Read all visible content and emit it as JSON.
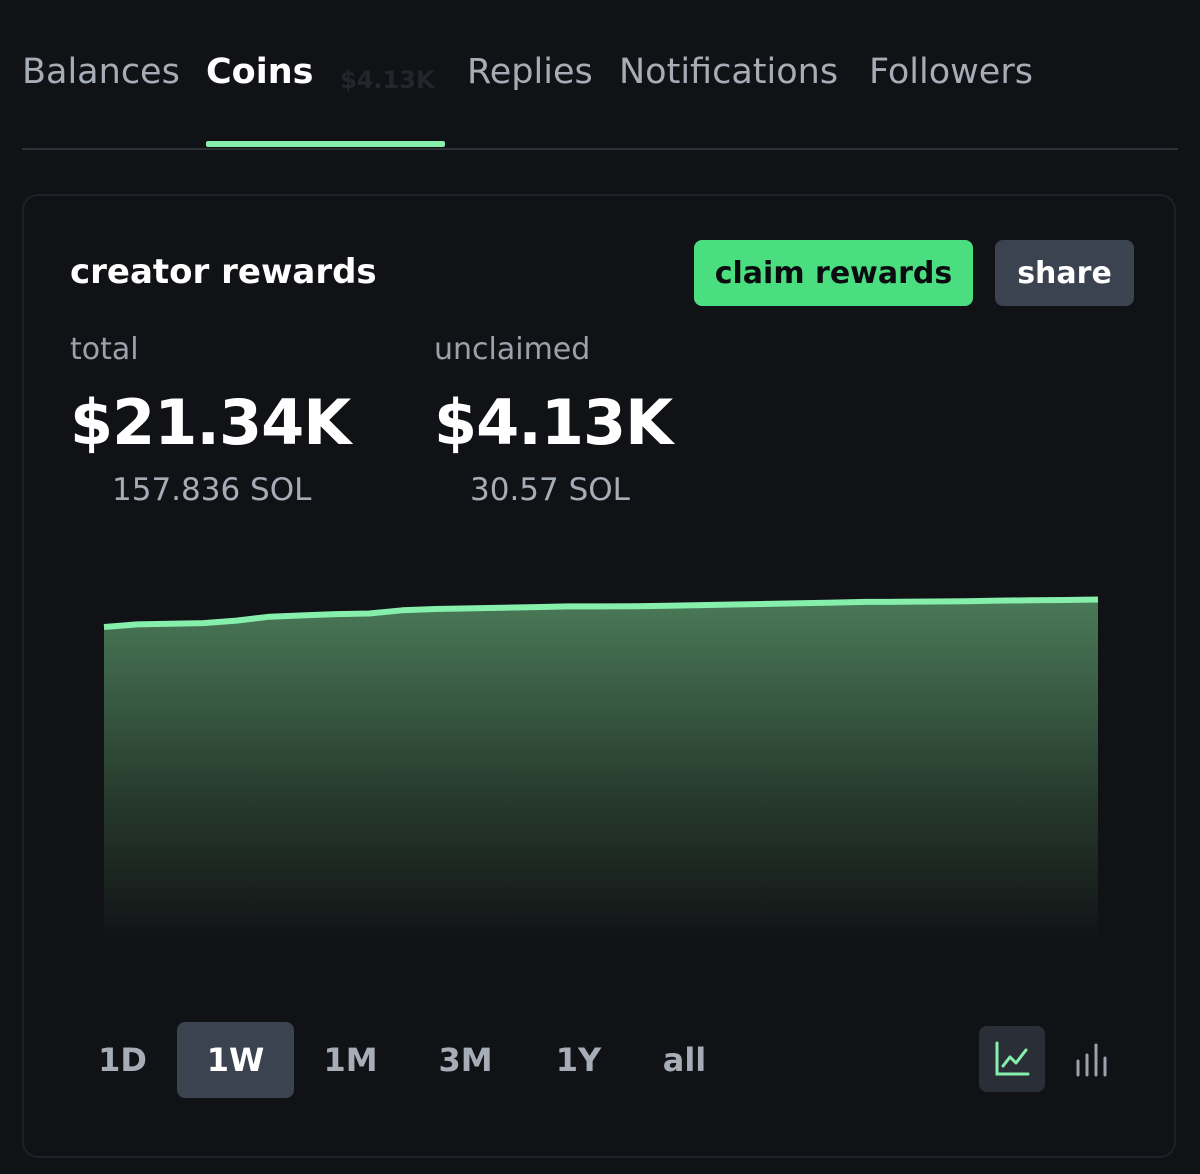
{
  "tabs": [
    {
      "label": "Balances",
      "active": false
    },
    {
      "label": "Coins",
      "active": true
    },
    {
      "label": "$4.13K",
      "active": false,
      "badge": true
    },
    {
      "label": "Replies",
      "active": false
    },
    {
      "label": "Notifications",
      "active": false
    },
    {
      "label": "Followers",
      "active": false
    }
  ],
  "card": {
    "title": "creator rewards",
    "claim_label": "claim rewards",
    "share_label": "share",
    "total": {
      "label": "total",
      "value": "$21.34K",
      "sub": "157.836 SOL"
    },
    "unclaimed": {
      "label": "unclaimed",
      "value": "$4.13K",
      "sub": "30.57 SOL"
    }
  },
  "time_ranges": [
    {
      "label": "1D",
      "active": false
    },
    {
      "label": "1W",
      "active": true
    },
    {
      "label": "1M",
      "active": false
    },
    {
      "label": "3M",
      "active": false
    },
    {
      "label": "1Y",
      "active": false
    },
    {
      "label": "all",
      "active": false
    }
  ],
  "chart_toggles": [
    {
      "icon": "line-chart-icon",
      "active": true
    },
    {
      "icon": "bar-chart-icon",
      "active": false
    }
  ],
  "colors": {
    "accent": "#4ade80",
    "line": "#86efac",
    "background": "#111216",
    "button_secondary": "#3b4350"
  },
  "chart_data": {
    "type": "area",
    "x": [
      0,
      1,
      2,
      3,
      4,
      5,
      6,
      7,
      8,
      9,
      10,
      11,
      12,
      13,
      14,
      15,
      16,
      17,
      18,
      19,
      20,
      21,
      22,
      23,
      24,
      25,
      26,
      27,
      28,
      29,
      30
    ],
    "values": [
      19.2,
      19.4,
      19.45,
      19.5,
      19.7,
      20.0,
      20.1,
      20.2,
      20.25,
      20.5,
      20.6,
      20.65,
      20.7,
      20.75,
      20.8,
      20.8,
      20.82,
      20.85,
      20.9,
      20.95,
      21.0,
      21.05,
      21.1,
      21.15,
      21.16,
      21.18,
      21.2,
      21.25,
      21.28,
      21.3,
      21.34
    ],
    "ylim": [
      0,
      21.34
    ],
    "title": "",
    "xlabel": "",
    "ylabel": "",
    "grid": false
  }
}
